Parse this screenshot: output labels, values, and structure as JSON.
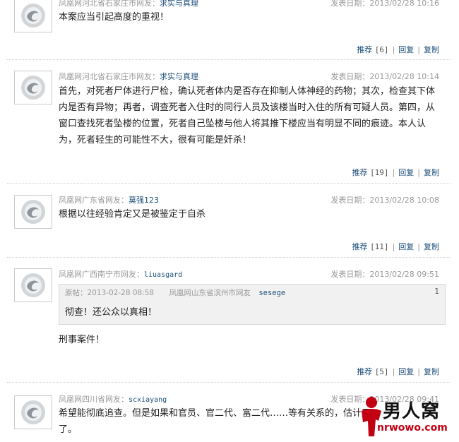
{
  "comments": [
    {
      "source": "凤凰网河北省石家庄市网友：",
      "user": "求实与真理",
      "date": "发表日期：2013/02/28 10:16",
      "body": "本案应当引起高度的重视！",
      "recommend_label": "推荐",
      "recommend_count": "[6]",
      "reply_label": "回复",
      "copy_label": "复制"
    },
    {
      "source": "凤凰网河北省石家庄市网友：",
      "user": "求实与真理",
      "date": "发表日期：2013/02/28 10:14",
      "body": "首先，对死者尸体进行尸检，确认死者体内是否存在抑制人体神经的药物；其次，检查其下体内是否有异物；再者，调查死者入住时的同行人员及该楼当时入住的所有可疑人员。第四，从窗口查找死者坠楼的位置，死者自己坠楼与他人将其推下楼应当有明显不同的痕迹。本人认为，死者轻生的可能性不大，很有可能是奸杀！",
      "recommend_label": "推荐",
      "recommend_count": "[19]",
      "reply_label": "回复",
      "copy_label": "复制"
    },
    {
      "source": "凤凰网广东省网友：",
      "user": "莫强123",
      "date": "发表日期：2013/02/28 10:08",
      "body": "根据以往经验肯定又是被鉴定于自杀",
      "recommend_label": "推荐",
      "recommend_count": "[11]",
      "reply_label": "回复",
      "copy_label": "复制"
    },
    {
      "source": "凤凰网广西南宁市网友：",
      "user": "liuasgard",
      "date": "发表日期：2013/02/28 09:51",
      "quote": {
        "header": "原帖：2013-02-28 08:58",
        "source": "凤凰网山东省滨州市网友",
        "user": "sesege",
        "number": "1",
        "text": "彻查！还公众以真相！"
      },
      "body": "刑事案件！",
      "recommend_label": "推荐",
      "recommend_count": "[5]",
      "reply_label": "回复",
      "copy_label": "复制"
    },
    {
      "source": "凤凰网四川省网友：",
      "user": "scxiayang",
      "date": "发表日期：2013/02/28 09:41",
      "body_line1": "希望能彻底追查。但是如果和官员、官二代、富二代……等有关系的，估计又",
      "body_line2": "了。"
    }
  ],
  "watermark": {
    "title": "男人窝",
    "url": "nrwowo.com"
  },
  "colors": {
    "link": "#1e4f7a",
    "meta": "#999999",
    "watermark_red": "#c20012"
  }
}
